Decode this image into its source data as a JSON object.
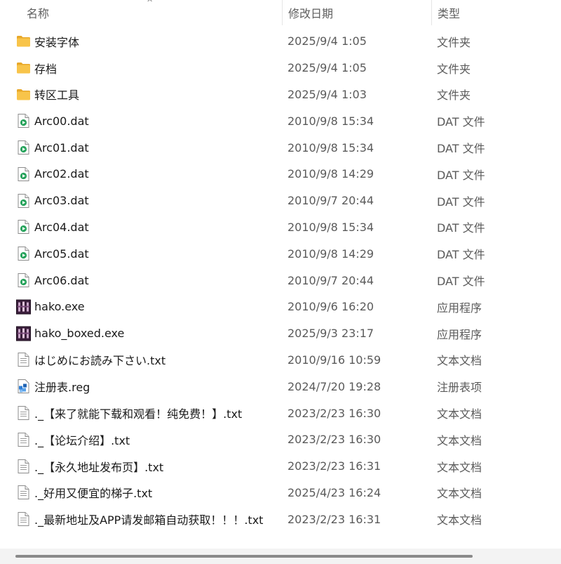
{
  "columns": {
    "name": "名称",
    "date": "修改日期",
    "type": "类型"
  },
  "sort_indicator": "^",
  "files": [
    {
      "name": "安装字体",
      "date": "2025/9/4 1:05",
      "type": "文件夹",
      "icon": "folder-icon"
    },
    {
      "name": "存档",
      "date": "2025/9/4 1:05",
      "type": "文件夹",
      "icon": "folder-icon"
    },
    {
      "name": "转区工具",
      "date": "2025/9/4 1:03",
      "type": "文件夹",
      "icon": "folder-icon"
    },
    {
      "name": "Arc00.dat",
      "date": "2010/9/8 15:34",
      "type": "DAT 文件",
      "icon": "media-file-icon"
    },
    {
      "name": "Arc01.dat",
      "date": "2010/9/8 15:34",
      "type": "DAT 文件",
      "icon": "media-file-icon"
    },
    {
      "name": "Arc02.dat",
      "date": "2010/9/8 14:29",
      "type": "DAT 文件",
      "icon": "media-file-icon"
    },
    {
      "name": "Arc03.dat",
      "date": "2010/9/7 20:44",
      "type": "DAT 文件",
      "icon": "media-file-icon"
    },
    {
      "name": "Arc04.dat",
      "date": "2010/9/8 15:34",
      "type": "DAT 文件",
      "icon": "media-file-icon"
    },
    {
      "name": "Arc05.dat",
      "date": "2010/9/8 14:29",
      "type": "DAT 文件",
      "icon": "media-file-icon"
    },
    {
      "name": "Arc06.dat",
      "date": "2010/9/7 20:44",
      "type": "DAT 文件",
      "icon": "media-file-icon"
    },
    {
      "name": "hako.exe",
      "date": "2010/9/6 16:20",
      "type": "应用程序",
      "icon": "app-icon"
    },
    {
      "name": "hako_boxed.exe",
      "date": "2025/9/3 23:17",
      "type": "应用程序",
      "icon": "app-icon"
    },
    {
      "name": "はじめにお読み下さい.txt",
      "date": "2010/9/16 10:59",
      "type": "文本文档",
      "icon": "text-file-icon"
    },
    {
      "name": "注册表.reg",
      "date": "2024/7/20 19:28",
      "type": "注册表项",
      "icon": "registry-file-icon"
    },
    {
      "name": "._【来了就能下载和观看！纯免费！】.txt",
      "date": "2023/2/23 16:30",
      "type": "文本文档",
      "icon": "text-file-icon"
    },
    {
      "name": "._【论坛介绍】.txt",
      "date": "2023/2/23 16:30",
      "type": "文本文档",
      "icon": "text-file-icon"
    },
    {
      "name": "._【永久地址发布页】.txt",
      "date": "2023/2/23 16:31",
      "type": "文本文档",
      "icon": "text-file-icon"
    },
    {
      "name": "._好用又便宜的梯子.txt",
      "date": "2025/4/23 16:24",
      "type": "文本文档",
      "icon": "text-file-icon"
    },
    {
      "name": "._最新地址及APP请发邮箱自动获取！！！.txt",
      "date": "2023/2/23 16:31",
      "type": "文本文档",
      "icon": "text-file-icon"
    }
  ],
  "colors": {
    "folder": "#F8C44A",
    "folder_dark": "#E8A82A",
    "media_green": "#27A35C",
    "app_bg": "#3B1F3C",
    "reg_blue": "#2F7FD6"
  }
}
